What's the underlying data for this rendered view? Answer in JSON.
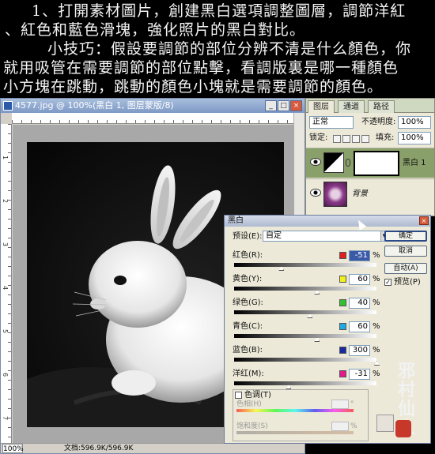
{
  "tutorial": {
    "line1": "1、打開素材圖片，創建黑白選項調整圖層，調節洋紅",
    "line2": "、紅色和藍色滑塊，強化照片的黑白對比。",
    "line3": "小技巧：假設要調節的部位分辨不清是什么顏色，你",
    "line4": "就用吸管在需要調節的部位點擊，看調版裏是哪一種顏色",
    "line5": "小方塊在跳動，跳動的顏色小塊就是需要調節的顏色。"
  },
  "document": {
    "title": "4577.jpg @ 100%(黑白 1, 图层蒙版/8)",
    "ruler_nums": [
      "1",
      "2",
      "3",
      "4",
      "5",
      "6",
      "7"
    ],
    "status_zoom": "100%",
    "status_doc": "文档:596.9K/596.9K"
  },
  "layers_panel": {
    "tabs": [
      "图层",
      "通道",
      "路径"
    ],
    "blend_mode": "正常",
    "opacity_label": "不透明度:",
    "opacity_value": "100%",
    "lock_label": "锁定:",
    "fill_label": "填充:",
    "fill_value": "100%",
    "layers": [
      {
        "name": "黑白 1",
        "type": "adjustment",
        "selected": true
      },
      {
        "name": "背景",
        "type": "image",
        "selected": false
      }
    ]
  },
  "dialog": {
    "title": "黑白",
    "preset_label": "预设(E):",
    "preset_value": "自定",
    "buttons": {
      "ok": "确定",
      "cancel": "取消",
      "auto": "自动(A)"
    },
    "preview_label": "预览(P)",
    "preview_checked": true,
    "sliders": [
      {
        "label": "红色(R):",
        "value": "-51",
        "color": "#e02020",
        "track": "linear-gradient(90deg,#000,#fff)",
        "pos": 0.33,
        "highlight": true
      },
      {
        "label": "黄色(Y):",
        "value": "60",
        "color": "#f0f020",
        "track": "linear-gradient(90deg,#000,#fff)",
        "pos": 0.58,
        "highlight": false
      },
      {
        "label": "绿色(G):",
        "value": "40",
        "color": "#30c030",
        "track": "linear-gradient(90deg,#000,#fff)",
        "pos": 0.53,
        "highlight": false
      },
      {
        "label": "青色(C):",
        "value": "60",
        "color": "#20a8e0",
        "track": "linear-gradient(90deg,#000,#fff)",
        "pos": 0.58,
        "highlight": false
      },
      {
        "label": "蓝色(B):",
        "value": "300",
        "color": "#1a2aa0",
        "track": "linear-gradient(90deg,#000,#fff)",
        "pos": 1.0,
        "highlight": false
      },
      {
        "label": "洋红(M):",
        "value": "-31",
        "color": "#e01a8a",
        "track": "linear-gradient(90deg,#000,#fff)",
        "pos": 0.38,
        "highlight": false
      }
    ],
    "tint_label": "色调(T)",
    "hue_label": "色相(H)",
    "saturation_label": "饱和度(S)",
    "pct": "%",
    "deg": "°"
  },
  "signature": {
    "text": "邪村仙人"
  }
}
